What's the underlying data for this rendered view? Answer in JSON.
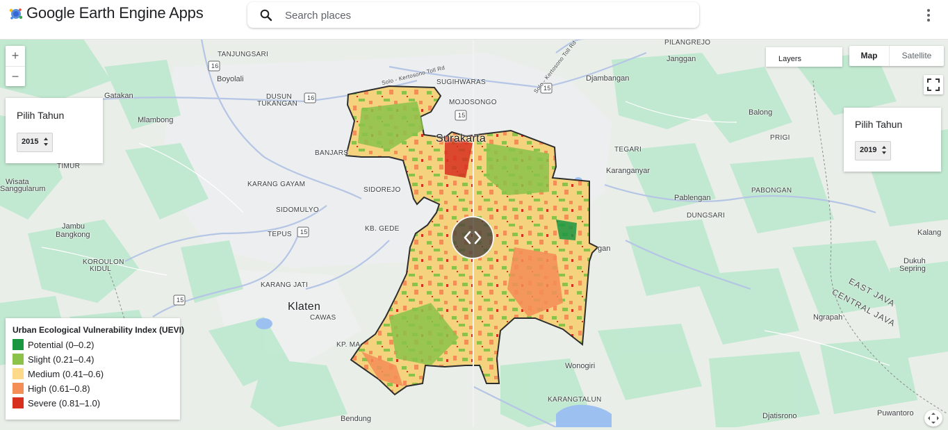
{
  "header": {
    "title": "Google Earth Engine Apps",
    "search_placeholder": "Search places"
  },
  "controls": {
    "zoom_in": "+",
    "zoom_out": "−",
    "layers_label": "Layers",
    "map_type_map": "Map",
    "map_type_satellite": "Satellite"
  },
  "left_panel": {
    "label": "Pilih Tahun",
    "year": "2015"
  },
  "right_panel": {
    "label": "Pilih Tahun",
    "year": "2019"
  },
  "legend": {
    "title": "Urban Ecological Vulnerability Index (UEVI)",
    "items": [
      {
        "label": "Potential (0–0.2)",
        "color": "#1a9641"
      },
      {
        "label": "Slight (0.21–0.4)",
        "color": "#8bc34a"
      },
      {
        "label": "Medium (0.41–0.6)",
        "color": "#fdd98a"
      },
      {
        "label": "High (0.61–0.8)",
        "color": "#f58d57"
      },
      {
        "label": "Severe (0.81–1.0)",
        "color": "#d7301f"
      }
    ]
  },
  "map_labels": {
    "tanjungsari": "TANJUNGSARI",
    "boyolali": "Boyolali",
    "gatakan": "Gatakan",
    "dusun_tukangan_1": "DUSUN",
    "dusun_tukangan_2": "TUKANGAN",
    "mlambong": "Mlambong",
    "banjarsari": "BANJARS",
    "timur": "TIMUR",
    "wisata": "Wisata",
    "sanggularum": "Sanggularum",
    "karang_gayam": "KARANG GAYAM",
    "sidorejo": "SIDOREJO",
    "sidomulyo": "SIDOMULYO",
    "kb_gede": "KB. GEDE",
    "jambu": "Jambu",
    "bangkong": "Bangkong",
    "tepus": "TEPUS",
    "koroulon_1": "KOROULON",
    "koroulon_2": "KIDUL",
    "karang_jati": "KARANG JATI",
    "klaten": "Klaten",
    "cawas": "CAWAS",
    "kp_ma": "KP. MA",
    "bendung": "Bendung",
    "sugihwaras": "SUGIHWARAS",
    "mojosongo": "MOJOSONGO",
    "surakarta": "Surakarta",
    "solo_toll_1": "Solo - Kertosono Toll Rd",
    "solo_toll_2": "Solo - Kertosono Toll Rd",
    "pilangrejo": "PILANGREJO",
    "janggan": "Janggan",
    "djambangan": "Djambangan",
    "balong": "Balong",
    "tegari": "TEGARI",
    "prigi": "PRIGI",
    "karanganyar": "Karanganyar",
    "pabongan": "PABONGAN",
    "pablengan": "Pablengan",
    "dungsari": "DUNGSARI",
    "kalang": "Kalang",
    "gan": "gan",
    "dukuh_1": "Dukuh",
    "dukuh_2": "Sepring",
    "east_java": "EAST JAVA",
    "central_java": "CENTRAL JAVA",
    "ngrapah": "Ngrapah",
    "wonogiri": "Wonogiri",
    "karangtalun": "KARANGTALUN",
    "djatisrono": "Djatisrono",
    "puwantoro": "Puwantoro",
    "road_16a": "16",
    "road_16b": "16",
    "road_15a": "15",
    "road_15b": "15",
    "road_15c": "15",
    "road_15d": "15"
  },
  "colors": {
    "map_background": "#e8efe7",
    "forest": "#bfe8cf",
    "road": "#b5c5e5",
    "boundary": "#2d2d2d"
  }
}
